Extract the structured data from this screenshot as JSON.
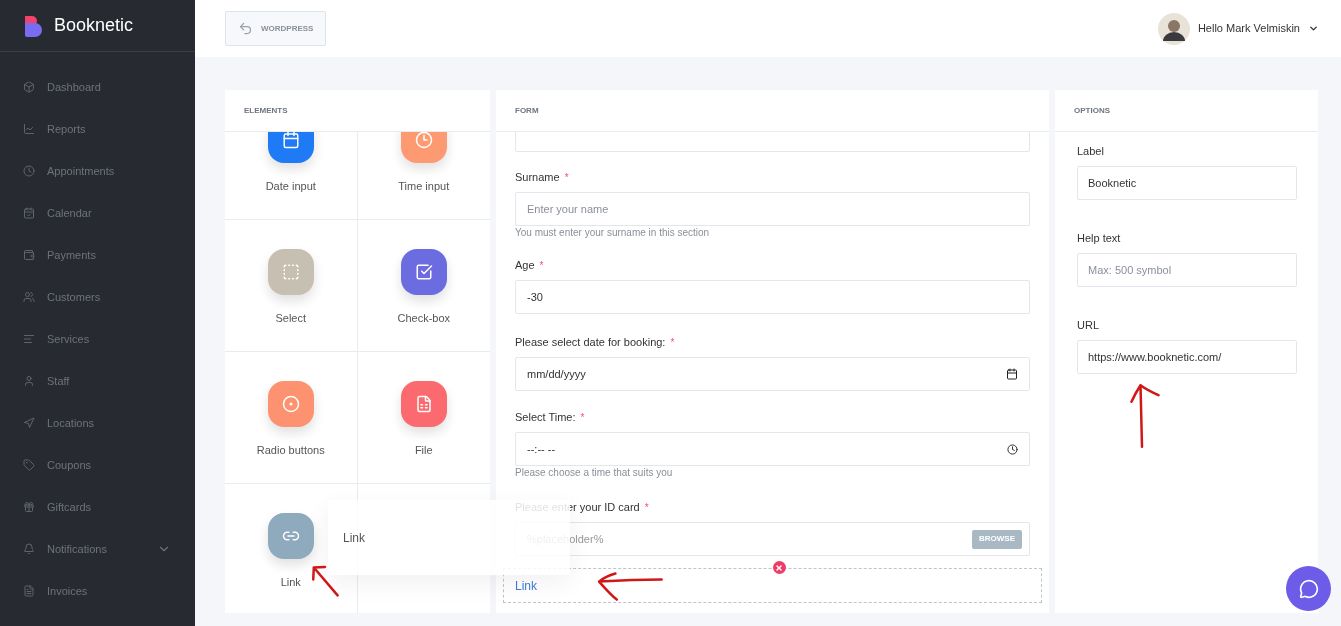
{
  "brand": {
    "name": "Booknetic"
  },
  "sidebar": {
    "items": [
      {
        "label": "Dashboard",
        "has_submenu": false
      },
      {
        "label": "Reports",
        "has_submenu": false
      },
      {
        "label": "Appointments",
        "has_submenu": false
      },
      {
        "label": "Calendar",
        "has_submenu": false
      },
      {
        "label": "Payments",
        "has_submenu": false
      },
      {
        "label": "Customers",
        "has_submenu": false
      },
      {
        "label": "Services",
        "has_submenu": false
      },
      {
        "label": "Staff",
        "has_submenu": false
      },
      {
        "label": "Locations",
        "has_submenu": false
      },
      {
        "label": "Coupons",
        "has_submenu": false
      },
      {
        "label": "Giftcards",
        "has_submenu": false
      },
      {
        "label": "Notifications",
        "has_submenu": true
      },
      {
        "label": "Invoices",
        "has_submenu": false
      }
    ]
  },
  "header": {
    "back_button": "WORDPRESS",
    "user_greeting": "Hello Mark Velmiskin"
  },
  "elements_panel": {
    "title": "ELEMENTS",
    "items": [
      {
        "label": "Date input",
        "color": "#1e7bf5"
      },
      {
        "label": "Time input",
        "color": "#fd9a72"
      },
      {
        "label": "Select",
        "color": "#c8bfb3"
      },
      {
        "label": "Check-box",
        "color": "#6b6ce0"
      },
      {
        "label": "Radio buttons",
        "color": "#fd9270"
      },
      {
        "label": "File",
        "color": "#fa6a6e"
      },
      {
        "label": "Link",
        "color": "#8fa9bd"
      }
    ]
  },
  "drag_preview": {
    "label": "Link"
  },
  "form_panel": {
    "title": "FORM",
    "fields": [
      {
        "kind": "text",
        "label": "Surname",
        "required_mark": "*",
        "placeholder": "Enter your name",
        "help": "You must enter your surname in this section"
      },
      {
        "kind": "text",
        "label": "Age",
        "required_mark": "*",
        "value": "-30"
      },
      {
        "kind": "date",
        "label": "Please select date for booking:",
        "required_mark": "*",
        "placeholder": "mm/dd/yyyy"
      },
      {
        "kind": "time",
        "label": "Select Time:",
        "required_mark": "*",
        "placeholder": "--:-- --",
        "help": "Please choose a time that suits you"
      },
      {
        "kind": "file",
        "label": "Please enter your ID card",
        "required_mark": "*",
        "placeholder": "%placeholder%",
        "button": "BROWSE"
      },
      {
        "kind": "link",
        "label": "Link",
        "selected": true
      }
    ]
  },
  "options_panel": {
    "title": "OPTIONS",
    "fields": [
      {
        "label": "Label",
        "value": "Booknetic"
      },
      {
        "label": "Help text",
        "placeholder": "Max: 500 symbol"
      },
      {
        "label": "URL",
        "value": "https://www.booknetic.com/"
      }
    ]
  }
}
